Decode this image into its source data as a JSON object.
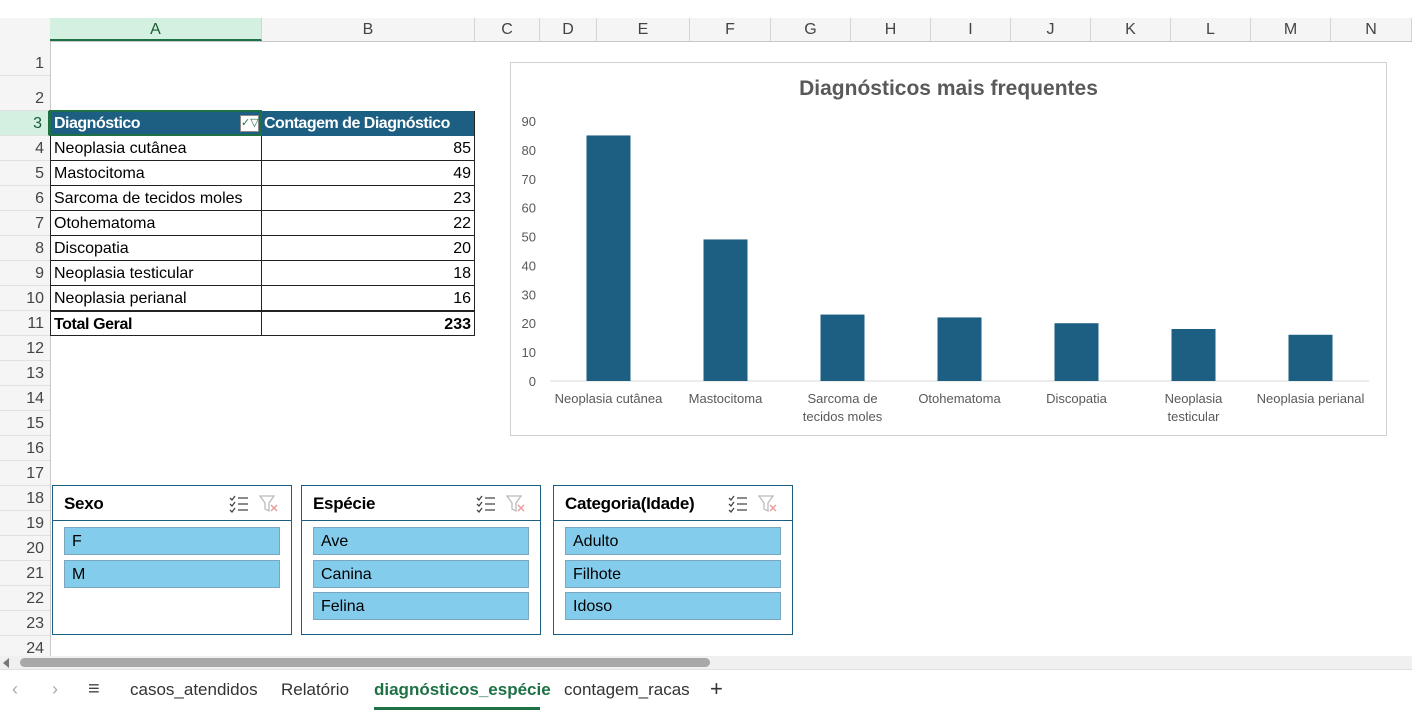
{
  "columns": [
    "A",
    "B",
    "C",
    "D",
    "E",
    "F",
    "G",
    "H",
    "I",
    "J",
    "K",
    "L",
    "M",
    "N"
  ],
  "rows": [
    "1",
    "2",
    "3",
    "4",
    "5",
    "6",
    "7",
    "8",
    "9",
    "10",
    "11",
    "12",
    "13",
    "14",
    "15",
    "16",
    "17",
    "18",
    "19",
    "20",
    "21",
    "22",
    "23",
    "24"
  ],
  "pivot": {
    "header_diag": "Diagnóstico",
    "header_count": "Contagem de Diagnóstico",
    "filter_icon": "filter-dropdown-icon",
    "rows": [
      {
        "label": "Neoplasia cutânea",
        "value": "85"
      },
      {
        "label": "Mastocitoma",
        "value": "49"
      },
      {
        "label": "Sarcoma de tecidos moles",
        "value": "23"
      },
      {
        "label": "Otohematoma",
        "value": "22"
      },
      {
        "label": "Discopatia",
        "value": "20"
      },
      {
        "label": "Neoplasia testicular",
        "value": "18"
      },
      {
        "label": "Neoplasia perianal",
        "value": "16"
      }
    ],
    "total_label": "Total Geral",
    "total_value": "233"
  },
  "chart_data": {
    "type": "bar",
    "title": "Diagnósticos mais frequentes",
    "categories": [
      "Neoplasia cutânea",
      "Mastocitoma",
      "Sarcoma de tecidos moles",
      "Otohematoma",
      "Discopatia",
      "Neoplasia testicular",
      "Neoplasia perianal"
    ],
    "category_label_lines": [
      [
        "Neoplasia cutânea"
      ],
      [
        "Mastocitoma"
      ],
      [
        "Sarcoma de",
        "tecidos moles"
      ],
      [
        "Otohematoma"
      ],
      [
        "Discopatia"
      ],
      [
        "Neoplasia",
        "testicular"
      ],
      [
        "Neoplasia perianal"
      ]
    ],
    "values": [
      85,
      49,
      23,
      22,
      20,
      18,
      16
    ],
    "yticks": [
      0,
      10,
      20,
      30,
      40,
      50,
      60,
      70,
      80,
      90
    ],
    "ylim": [
      0,
      90
    ],
    "bar_color": "#1c5f82",
    "xlabel": "",
    "ylabel": "",
    "grid": false,
    "legend": "none"
  },
  "slicers": {
    "sexo": {
      "title": "Sexo",
      "items": [
        "F",
        "M"
      ]
    },
    "especie": {
      "title": "Espécie",
      "items": [
        "Ave",
        "Canina",
        "Felina"
      ]
    },
    "categoria": {
      "title": "Categoria(Idade)",
      "items": [
        "Adulto",
        "Filhote",
        "Idoso"
      ]
    }
  },
  "tabs": {
    "items": [
      "casos_atendidos",
      "Relatório",
      "diagnósticos_espécie",
      "contagem_racas"
    ],
    "active": "diagnósticos_espécie",
    "add_label": "+",
    "menu_label": "≡",
    "prev_label": "‹",
    "next_label": "›"
  },
  "colors": {
    "header_fill": "#1c5f82",
    "slicer_item_fill": "#84ccec",
    "active_tab": "#1e7145"
  }
}
